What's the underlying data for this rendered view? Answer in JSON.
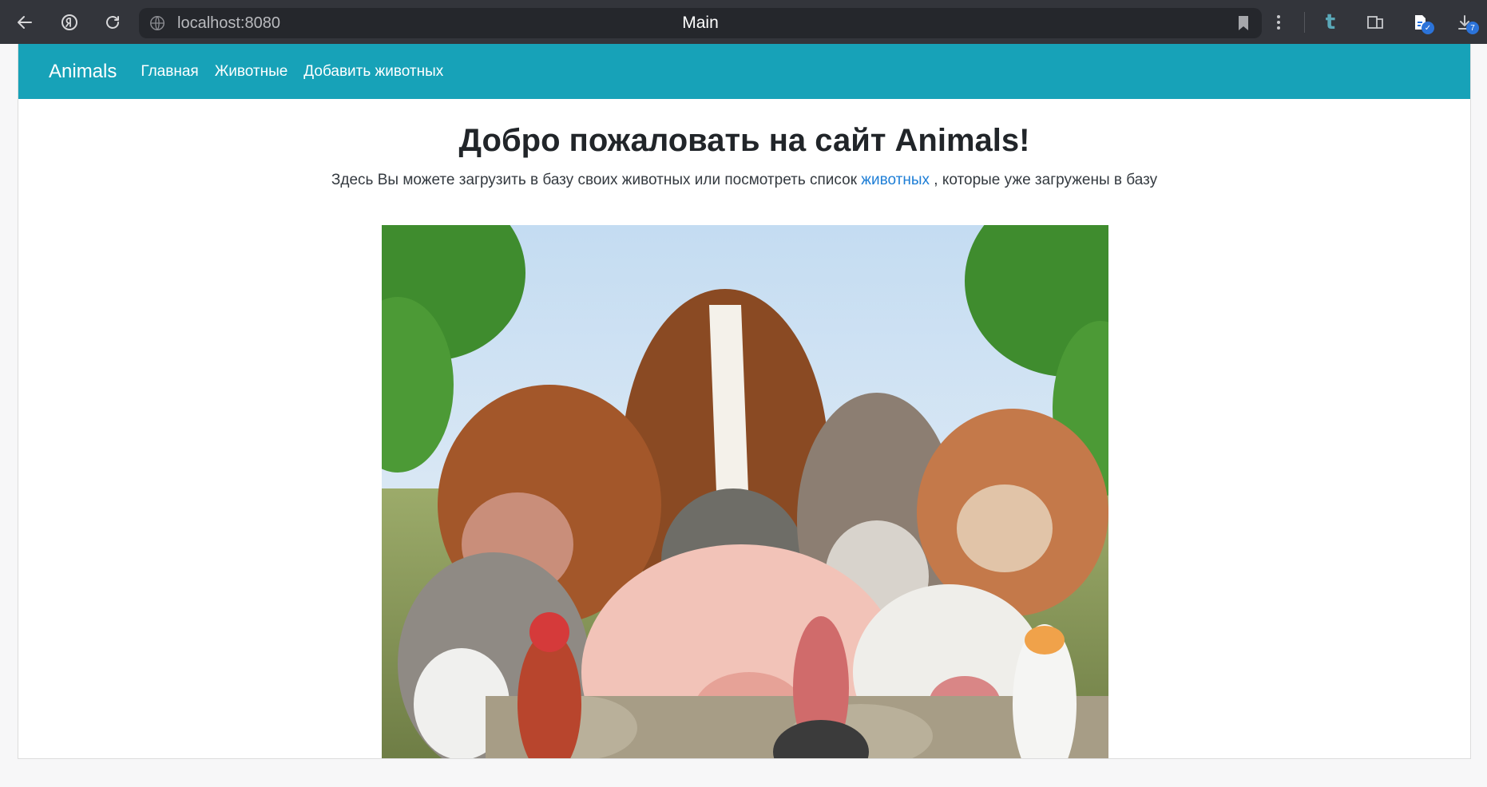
{
  "browser": {
    "url": "localhost:8080",
    "tab_title": "Main",
    "downloads_badge": "7",
    "icons": [
      "back-icon",
      "yandex-icon",
      "reload-icon",
      "globe-icon",
      "bookmark-icon",
      "more-icon",
      "tumblr-icon",
      "collections-icon",
      "extension-icon",
      "download-icon"
    ]
  },
  "navbar": {
    "brand": "Animals",
    "links": [
      "Главная",
      "Животные",
      "Добавить животных"
    ]
  },
  "hero": {
    "title": "Добро пожаловать на сайт Animals!",
    "lead_before": "Здесь Вы можете загрузить в базу своих животных или посмотреть список ",
    "lead_link": "животных",
    "lead_after": " , которые уже загружены в базу"
  },
  "colors": {
    "navbar": "#17a2b8",
    "link": "#1e7ed6",
    "browser_chrome": "#33353b"
  }
}
